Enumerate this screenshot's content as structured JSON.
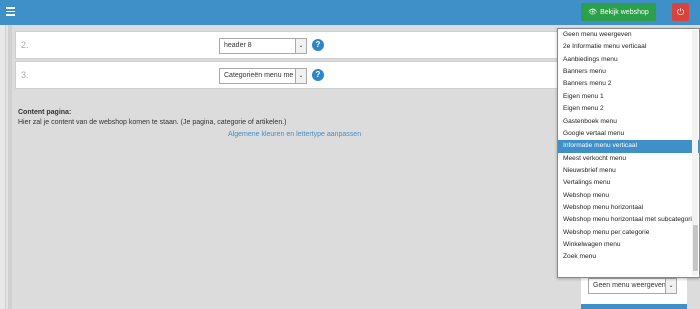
{
  "topbar": {
    "webshop_button": "Bekijk webshop",
    "icons": [
      "menu-icon",
      "eye-icon",
      "power-icon"
    ],
    "colors": {
      "bar": "#3f8fc9",
      "webshop": "#2c9f4a",
      "power": "#d9433b"
    }
  },
  "rows": [
    {
      "number": "2.",
      "select_value": "header 8"
    },
    {
      "number": "3.",
      "select_value": "Categorieën menu me"
    }
  ],
  "content": {
    "heading": "Content pagina:",
    "description": "Hier zal je content van de webshop komen te staan. (Je pagina, categorie of artikelen.)",
    "link": "Algemene kleuren en lettertype aanpassen"
  },
  "dropdown": {
    "selected_index": 9,
    "items": [
      "Geen menu weergeven",
      "2e Informatie menu verticaal",
      "Aanbiedings menu",
      "Banners menu",
      "Banners menu 2",
      "Eigen menu 1",
      "Eigen menu 2",
      "Gastenboek menu",
      "Google vertaal menu",
      "Informatie menu verticaal",
      "Meest verkocht menu",
      "Nieuwsbrief menu",
      "Vertalings menu",
      "Webshop menu",
      "Webshop menu horizontaal",
      "Webshop menu horizontaal met subcategorie",
      "Webshop menu per categorie",
      "Winkelwagen menu",
      "Zoek menu"
    ]
  },
  "bottom_select": {
    "value": "Geen menu weergeven"
  }
}
